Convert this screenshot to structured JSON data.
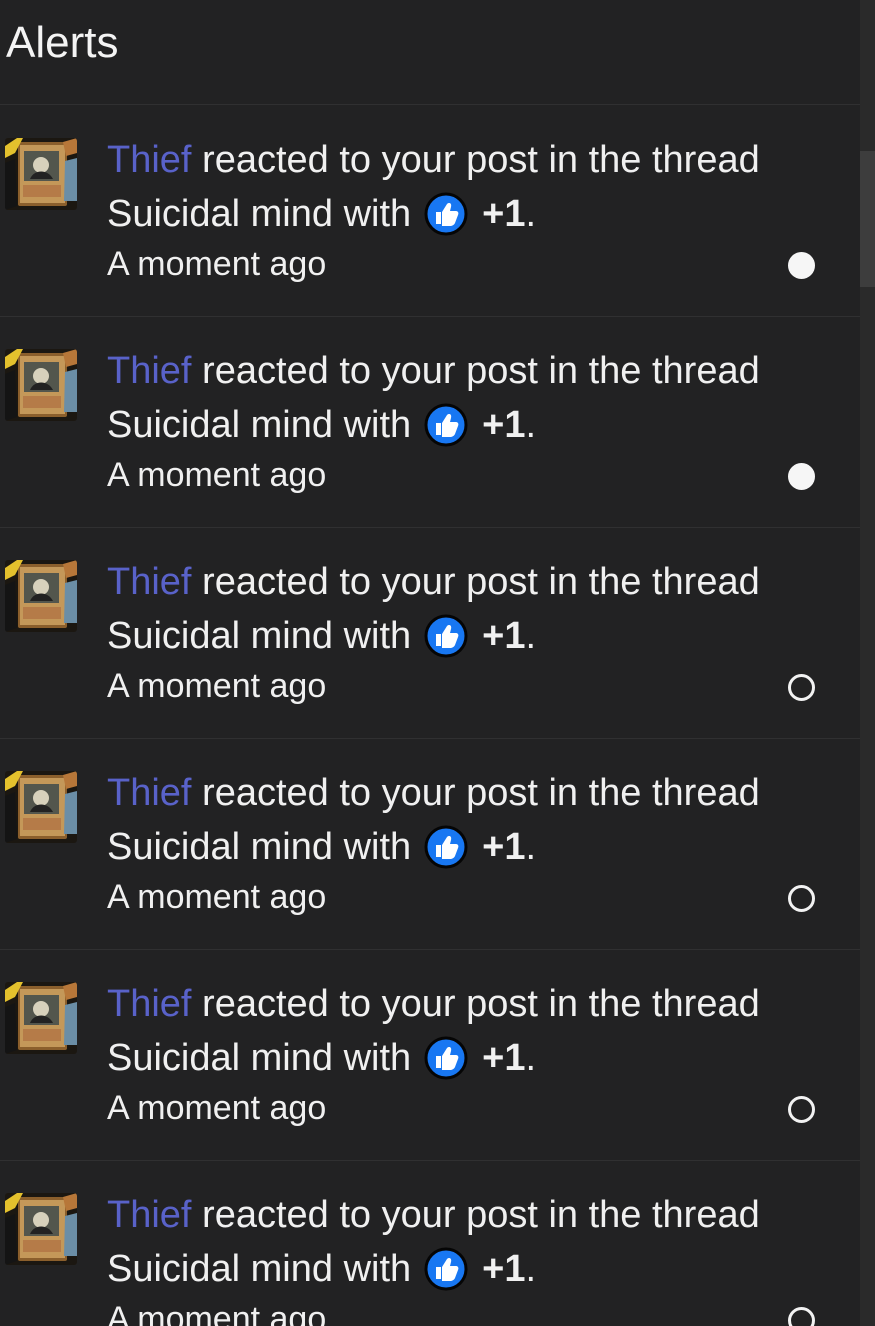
{
  "header": {
    "title": "Alerts"
  },
  "alerts": [
    {
      "username": "Thief",
      "action_text": " reacted to your post in the thread",
      "thread_title": "Suicidal mind",
      "with_text": "with",
      "reaction_icon": "thumbs-up-icon",
      "reaction": "+1",
      "period": ".",
      "timestamp": "A moment ago",
      "status": "unread"
    },
    {
      "username": "Thief",
      "action_text": " reacted to your post in the thread",
      "thread_title": "Suicidal mind",
      "with_text": "with",
      "reaction_icon": "thumbs-up-icon",
      "reaction": "+1",
      "period": ".",
      "timestamp": "A moment ago",
      "status": "unread"
    },
    {
      "username": "Thief",
      "action_text": " reacted to your post in the thread",
      "thread_title": "Suicidal mind",
      "with_text": "with",
      "reaction_icon": "thumbs-up-icon",
      "reaction": "+1",
      "period": ".",
      "timestamp": "A moment ago",
      "status": "read"
    },
    {
      "username": "Thief",
      "action_text": " reacted to your post in the thread",
      "thread_title": "Suicidal mind",
      "with_text": "with",
      "reaction_icon": "thumbs-up-icon",
      "reaction": "+1",
      "period": ".",
      "timestamp": "A moment ago",
      "status": "read"
    },
    {
      "username": "Thief",
      "action_text": " reacted to your post in the thread",
      "thread_title": "Suicidal mind",
      "with_text": "with",
      "reaction_icon": "thumbs-up-icon",
      "reaction": "+1",
      "period": ".",
      "timestamp": "A moment ago",
      "status": "read"
    },
    {
      "username": "Thief",
      "action_text": " reacted to your post in the thread",
      "thread_title": "Suicidal mind",
      "with_text": "with",
      "reaction_icon": "thumbs-up-icon",
      "reaction": "+1",
      "period": ".",
      "timestamp": "A moment ago",
      "status": "read"
    }
  ],
  "colors": {
    "background": "#222223",
    "username": "#5962c9",
    "reaction_blue": "#1877f2",
    "divider": "#303031"
  }
}
